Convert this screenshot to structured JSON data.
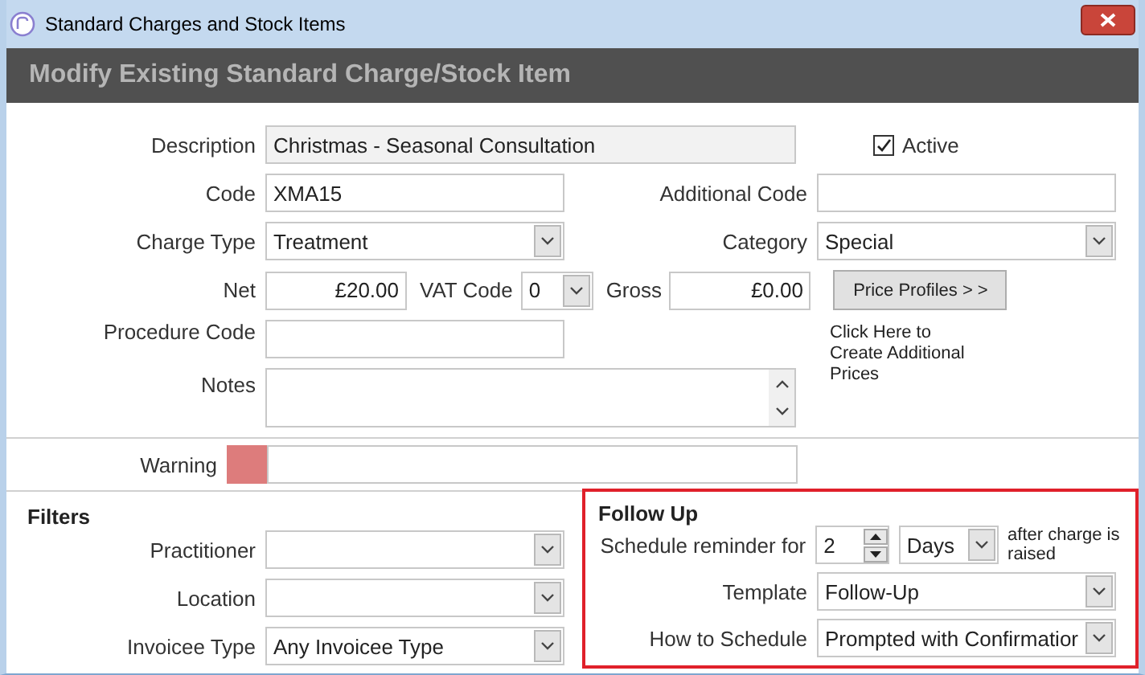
{
  "window": {
    "title": "Standard Charges and Stock Items"
  },
  "header": "Modify Existing Standard Charge/Stock Item",
  "description": {
    "label": "Description",
    "value": "Christmas - Seasonal Consultation"
  },
  "active": {
    "label": "Active",
    "checked": true
  },
  "code": {
    "label": "Code",
    "value": "XMA15"
  },
  "additional_code": {
    "label": "Additional Code"
  },
  "charge_type": {
    "label": "Charge Type",
    "value": "Treatment"
  },
  "category": {
    "label": "Category",
    "value": "Special"
  },
  "net": {
    "label": "Net",
    "value": "£20.00"
  },
  "vat_code": {
    "label": "VAT Code",
    "value": "0"
  },
  "gross": {
    "label": "Gross",
    "value": "£0.00"
  },
  "price_profiles": {
    "button": "Price Profiles > >",
    "hint": "Click Here to Create Additional Prices"
  },
  "procedure_code": {
    "label": "Procedure Code"
  },
  "notes": {
    "label": "Notes"
  },
  "warning": {
    "label": "Warning",
    "color": "#dd7c7c"
  },
  "filters": {
    "title": "Filters",
    "fields": [
      {
        "label": "Practitioner"
      },
      {
        "label": "Location"
      },
      {
        "label": "Invoicee Type",
        "value": "Any Invoicee Type"
      }
    ]
  },
  "follow_up": {
    "title": "Follow Up",
    "schedule_label": "Schedule reminder for",
    "amount": "2",
    "unit": "Days",
    "after_text": "after charge is raised",
    "template": {
      "label": "Template",
      "value": "Follow-Up"
    },
    "how": {
      "label": "How to Schedule",
      "value": "Prompted with Confirmatior"
    }
  }
}
